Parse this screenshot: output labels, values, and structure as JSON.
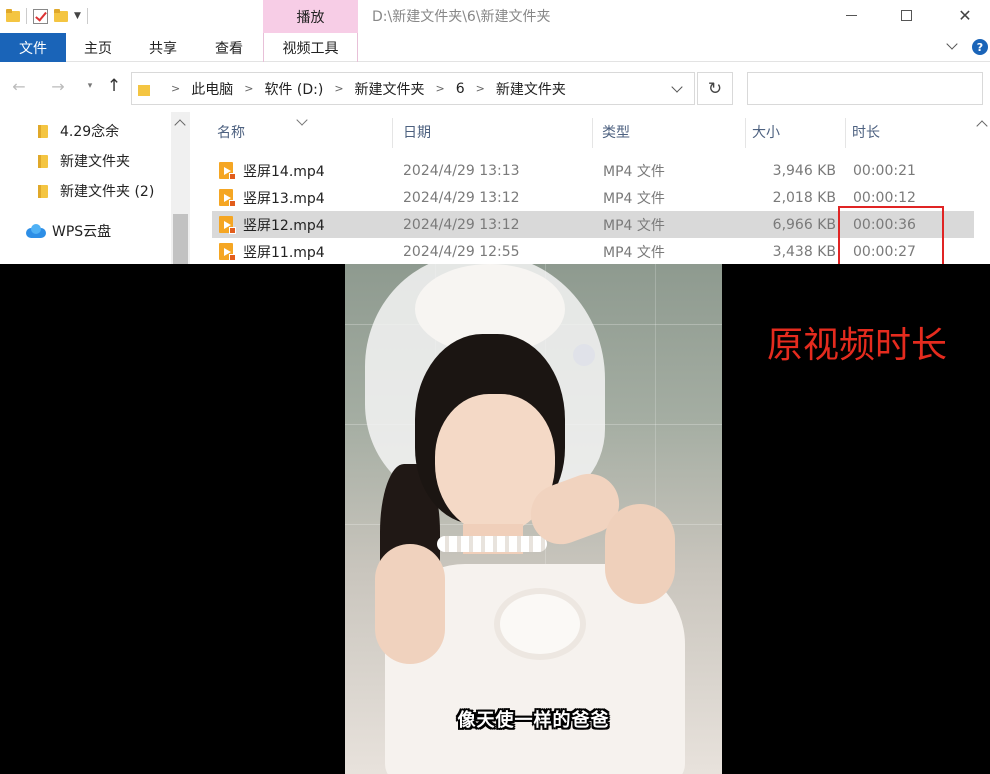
{
  "titlebar": {
    "context_tab": "播放",
    "path": "D:\\新建文件夹\\6\\新建文件夹",
    "minimize_icon": "minimize-icon",
    "maximize_icon": "maximize-icon",
    "close_glyph": "✕"
  },
  "ribbon": {
    "tabs": [
      "文件",
      "主页",
      "共享",
      "查看",
      "视频工具"
    ],
    "help_glyph": "?"
  },
  "navigation": {
    "back_glyph": "←",
    "forward_glyph": "→",
    "recent_glyph": "▾",
    "up_glyph": "↑",
    "breadcrumbs": [
      "此电脑",
      "软件 (D:)",
      "新建文件夹",
      "6",
      "新建文件夹"
    ],
    "separator_glyph": ">",
    "refresh_glyph": "↻",
    "search_placeholder": ""
  },
  "nav_pane": {
    "items": [
      "4.29念余",
      "新建文件夹",
      "新建文件夹 (2)"
    ],
    "wps": "WPS云盘"
  },
  "file_list": {
    "columns": [
      "名称",
      "日期",
      "类型",
      "大小",
      "时长"
    ],
    "rows": [
      {
        "name": "竖屏14.mp4",
        "date": "2024/4/29 13:13",
        "type": "MP4 文件",
        "size": "3,946 KB",
        "duration": "00:00:21",
        "selected": false
      },
      {
        "name": "竖屏13.mp4",
        "date": "2024/4/29 13:12",
        "type": "MP4 文件",
        "size": "2,018 KB",
        "duration": "00:00:12",
        "selected": false
      },
      {
        "name": "竖屏12.mp4",
        "date": "2024/4/29 13:12",
        "type": "MP4 文件",
        "size": "6,966 KB",
        "duration": "00:00:36",
        "selected": true
      },
      {
        "name": "竖屏11.mp4",
        "date": "2024/4/29 12:55",
        "type": "MP4 文件",
        "size": "3,438 KB",
        "duration": "00:00:27",
        "selected": false
      }
    ]
  },
  "video": {
    "subtitle": "像天使一样的爸爸",
    "annotation": "原视频时长",
    "annotation_color": "#e52b1e",
    "highlight_color": "#e02424"
  },
  "colors": {
    "file_tab": "#1a64b8",
    "context_tab": "#f7cde6",
    "selected_row": "#d9d9d9",
    "folder": "#f4c542"
  }
}
